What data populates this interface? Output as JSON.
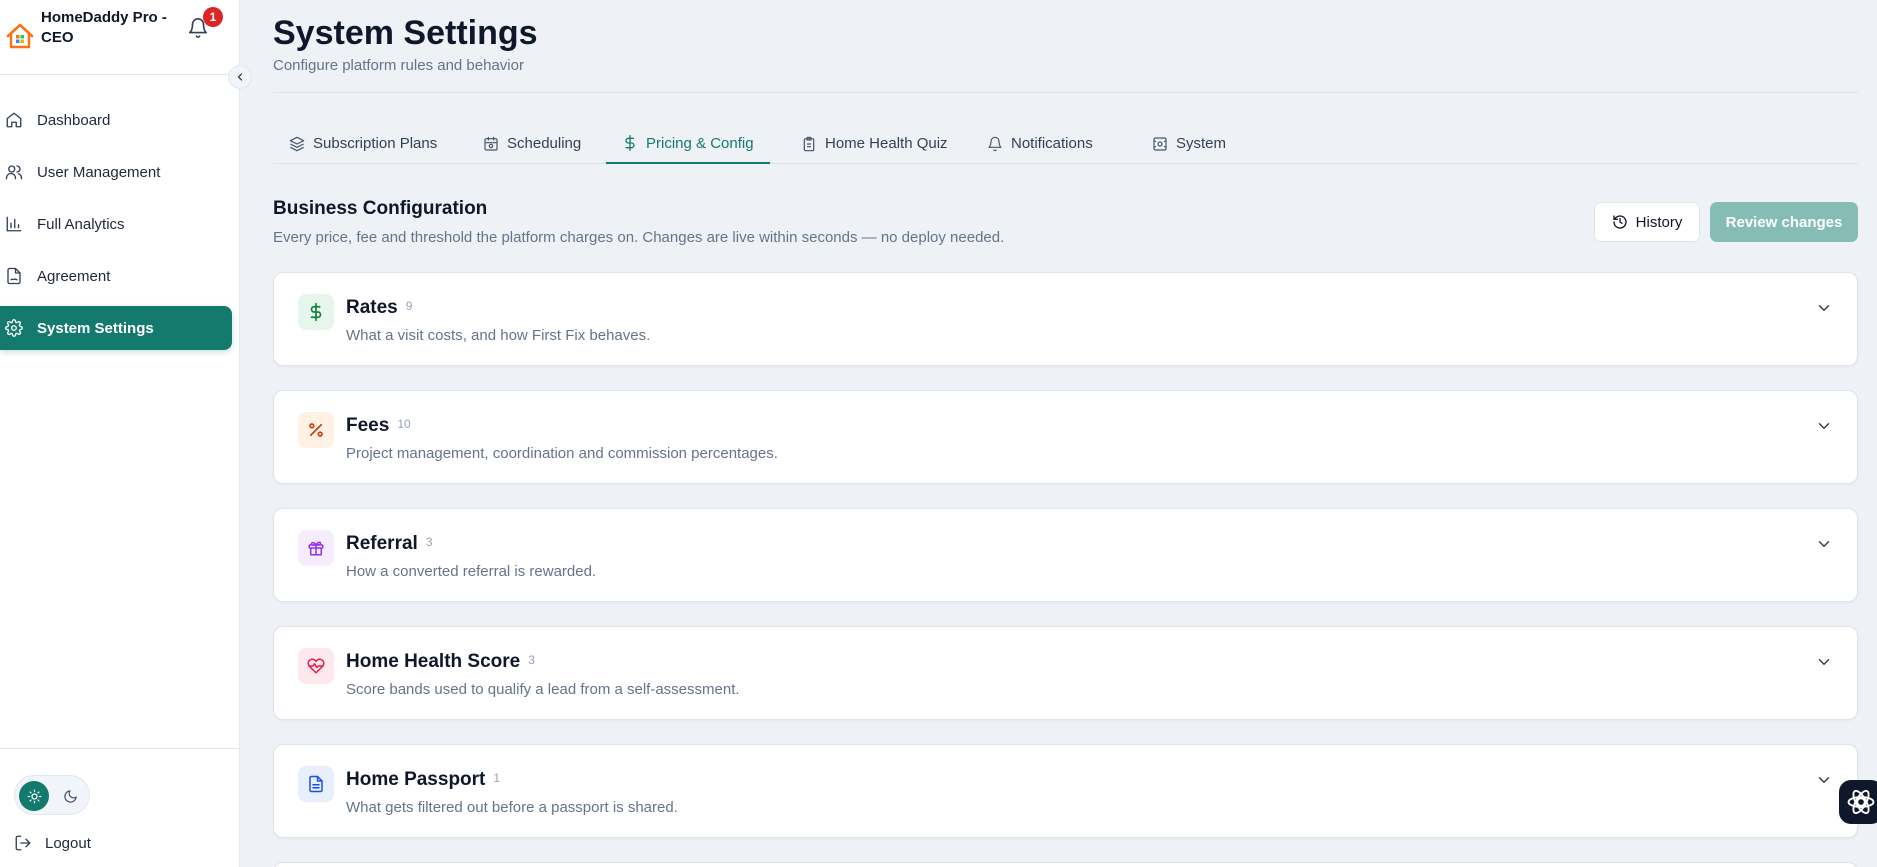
{
  "brand": {
    "name": "HomeDaddy Pro - CEO",
    "notifications_count": "1"
  },
  "sidebar": {
    "items": [
      {
        "label": "Dashboard",
        "icon": "home-icon"
      },
      {
        "label": "User Management",
        "icon": "users-icon"
      },
      {
        "label": "Full Analytics",
        "icon": "bar-chart-icon"
      },
      {
        "label": "Agreement",
        "icon": "file-signature-icon"
      },
      {
        "label": "System Settings",
        "icon": "gear-icon",
        "active": true
      }
    ],
    "logout_label": "Logout"
  },
  "header": {
    "title": "System Settings",
    "subtitle": "Configure platform rules and behavior"
  },
  "tabs": [
    {
      "label": "Subscription Plans",
      "icon": "layers-icon"
    },
    {
      "label": "Scheduling",
      "icon": "calendar-clock-icon"
    },
    {
      "label": "Pricing & Config",
      "icon": "dollar-icon",
      "active": true
    },
    {
      "label": "Home Health Quiz",
      "icon": "clipboard-icon"
    },
    {
      "label": "Notifications",
      "icon": "bell-icon"
    },
    {
      "label": "System",
      "icon": "server-icon"
    }
  ],
  "section": {
    "title": "Business Configuration",
    "description": "Every price, fee and threshold the platform charges on. Changes are live within seconds — no deploy needed.",
    "history_label": "History",
    "review_label": "Review changes"
  },
  "cards": [
    {
      "title": "Rates",
      "count": "9",
      "description": "What a visit costs, and how First Fix behaves.",
      "icon": "dollar-icon",
      "icon_color": "#15803d",
      "icon_bg": "#e6f6ec"
    },
    {
      "title": "Fees",
      "count": "10",
      "description": "Project management, coordination and commission percentages.",
      "icon": "percent-icon",
      "icon_color": "#c2410c",
      "icon_bg": "#fff1e4"
    },
    {
      "title": "Referral",
      "count": "3",
      "description": "How a converted referral is rewarded.",
      "icon": "gift-icon",
      "icon_color": "#9333ea",
      "icon_bg": "#f5ecfd"
    },
    {
      "title": "Home Health Score",
      "count": "3",
      "description": "Score bands used to qualify a lead from a self-assessment.",
      "icon": "heart-pulse-icon",
      "icon_color": "#e11d48",
      "icon_bg": "#fde8ee"
    },
    {
      "title": "Home Passport",
      "count": "1",
      "description": "What gets filtered out before a passport is shared.",
      "icon": "document-icon",
      "icon_color": "#1d4ed8",
      "icon_bg": "#e7effd"
    }
  ],
  "colors": {
    "accent": "#157a6e",
    "accent_disabled": "#85bdb4",
    "badge": "#dc2626"
  }
}
